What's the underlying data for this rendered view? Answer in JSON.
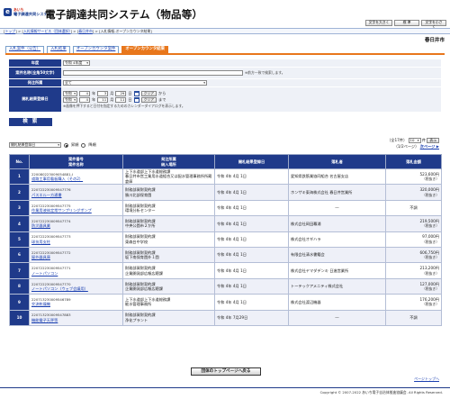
{
  "header": {
    "logo_line1": "あいち",
    "logo_line2": "電子調達共同システム",
    "system_title": "電子調達共同システム（物品等）",
    "buttons": [
      "文字を大きく",
      "標 準",
      "文字を小さく"
    ]
  },
  "breadcrumb": {
    "items": [
      "トップ",
      "入札情報サービス（団体選択）",
      "春日井市",
      "入札情報-オープンカウンタ結果"
    ],
    "separator": " > "
  },
  "city": "春日井市",
  "tabs": [
    "入札案件（公告）",
    "入札結果",
    "オープンカウンタ案件",
    "オープンカウンタ結果"
  ],
  "active_tab_index": 3,
  "form": {
    "labels": {
      "year": "年度",
      "case_name": "案件名称",
      "case_name_note": "(全角50文字)",
      "department": "発注所属",
      "date": "開札結果登録日"
    },
    "year_value": "令和 4年度",
    "case_name_value": "",
    "case_name_help": "※前方一致で検索します。",
    "department_value": "全て",
    "date_from": {
      "era": "令和",
      "year": "4",
      "month": "3",
      "day": "29"
    },
    "date_to": {
      "era": "令和",
      "year": "4",
      "month": "11",
      "day": "11"
    },
    "unit_year": "年",
    "unit_month": "月",
    "unit_day": "日",
    "clear_label": "クリア",
    "from_label": "から",
    "to_label": "まで",
    "calendar_help": "※画像を押下すると日付を指定するためのカレンダーダイアログを表示します。",
    "search_button": "検 索"
  },
  "results": {
    "sort_value": "開札結果登録日",
    "asc_label": "昇順",
    "desc_label": "降順",
    "total_text": "（全17件）",
    "per_page": "10",
    "per_page_unit": "件",
    "display_label": "表示",
    "page_text": "（1/2ページ）",
    "next_label": "次ページ ▶",
    "columns": [
      "No.",
      "案件番号\n案件名称",
      "発注所属\n納入場所",
      "開札結果登録日",
      "落札者",
      "落札金額"
    ],
    "rows": [
      {
        "no": "1",
        "case_no": "220080223009054881-I",
        "case_name": "道路工事用看板購入（その2）",
        "dept": "上下水道部上下水道総務課\n春日井市営工業用水道組合又は配水管理事務所所蔵倉庫",
        "date": "令和 4年  4月  1日",
        "winner": "愛知県鉄筋業協同組合 名古屋支店",
        "amount": "523,600円",
        "tax": "（税抜き）"
      },
      {
        "no": "2",
        "case_no": "220722230009547776",
        "case_name": "パスエル一方通書",
        "dept": "財務部資財契約課\n勝川北部保育園",
        "date": "令和 4年  4月  1日",
        "winner": "ホンザキ東海株式会社 春日井営業所",
        "amount": "320,000円",
        "tax": "（税抜き）"
      },
      {
        "no": "3",
        "case_no": "220722230009547775",
        "case_name": "作業用液体定常サンプリングポンプ",
        "dept": "財務部資財契約課\n環境分析センター",
        "date": "令和 4年  4月  1日",
        "winner": "―",
        "amount": "不調",
        "tax": ""
      },
      {
        "no": "4",
        "case_no": "220722230009547774",
        "case_name": "防災器具業",
        "dept": "財務部資財契約課\n中央公園市２か所",
        "date": "令和 4年  4月  1日",
        "winner": "株式会社岡田幕浦",
        "amount": "219,500円",
        "tax": "（税抜き）"
      },
      {
        "no": "5",
        "case_no": "220722230009547773",
        "case_name": "球技用支柱",
        "dept": "財務部資財契約課\n東森台中学校",
        "date": "令和 4年  4月  1日",
        "winner": "株式会社オギハラ",
        "amount": "97,000円",
        "tax": "（税抜き）"
      },
      {
        "no": "6",
        "case_no": "220722230009547772",
        "case_name": "屋外器具庫",
        "dept": "財務部資財契約課\n坂下南保育園外１園",
        "date": "令和 4年  4月  1日",
        "winner": "有限会社清水書籍会",
        "amount": "606,750円",
        "tax": "（税抜き）"
      },
      {
        "no": "7",
        "case_no": "220722230009547771",
        "case_name": "ノートパソコン",
        "dept": "財務部資財契約課\n企業開発部広報広聴課",
        "date": "令和 4年  4月  1日",
        "winner": "株式会社ヤマダデンキ 日進営業所",
        "amount": "213,200円",
        "tax": "（税抜き）"
      },
      {
        "no": "8",
        "case_no": "220722230009547770",
        "case_name": "ノートパソコン（ウェブ会議用）",
        "dept": "財務部資財契約課\n企業開発部広報広聴課",
        "date": "令和 4年  4月  1日",
        "winner": "トーテックアメニティ株式会社",
        "amount": "127,000円",
        "tax": "（税抜き）"
      },
      {
        "no": "9",
        "case_no": "220713230009546789",
        "case_name": "交流乾燥機",
        "dept": "上下水道部上下水道総務課\n能水管理事務所",
        "date": "令和 4年  4月  1日",
        "winner": "株式会社渡辺機器",
        "amount": "176,200円",
        "tax": "（税抜き）"
      },
      {
        "no": "10",
        "case_no": "220713230009547883",
        "case_name": "機能電子天秤等",
        "dept": "財務部資財契約課\n浄化プラント",
        "date": "令和 4年  7月29日",
        "winner": "―",
        "amount": "不調",
        "tax": ""
      }
    ]
  },
  "back_button": "団体のトップページへ戻る",
  "page_top": "ページトップへ",
  "footer": "Copyright © 2007-2022 あいち電子自治体推進協議会. All Rights Reserved.",
  "colors": {
    "navy": "#1f3a8a",
    "orange": "#e8771c",
    "link": "#1a3fb0"
  }
}
